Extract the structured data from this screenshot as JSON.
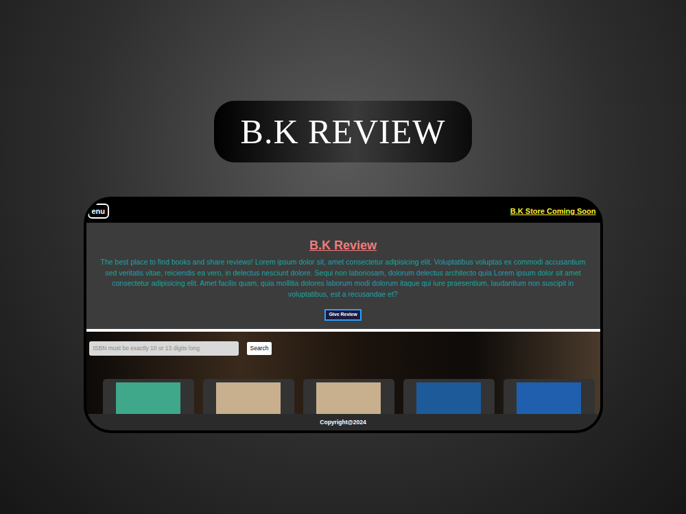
{
  "banner": {
    "title": "B.K REVIEW"
  },
  "nav": {
    "menu_button": "enu",
    "store_link": "B.K Store Coming Soon"
  },
  "hero": {
    "title": "B.K Review",
    "text": "The best place to find books and share reviews! Lorem ipsum dolor sit, amet consectetur adipisicing elit. Voluptatibus voluptas ex commodi accusantium sed veritatis vitae, reiciendis ea vero, in delectus nesciunt dolore. Sequi non laboriosam, dolorum delectus architecto quia Lorem ipsum dolor sit amet consectetur adipisicing elit. Amet facilis quam, quia mollitia dolores laborum modi dolorum itaque qui iure praesentium, laudantium non suscipit in voluptatibus, est a recusandae et?",
    "button": "Give Review"
  },
  "search": {
    "placeholder": "ISBN must be exactly 10 or 13 digits long",
    "button": "Search"
  },
  "books": [
    {
      "color": "#3fa88a"
    },
    {
      "color": "#c8b08e"
    },
    {
      "color": "#c8b08e"
    },
    {
      "color": "#1d5a9a"
    },
    {
      "color": "#1f5fae"
    }
  ],
  "footer": {
    "text": "Copyright@2024"
  }
}
